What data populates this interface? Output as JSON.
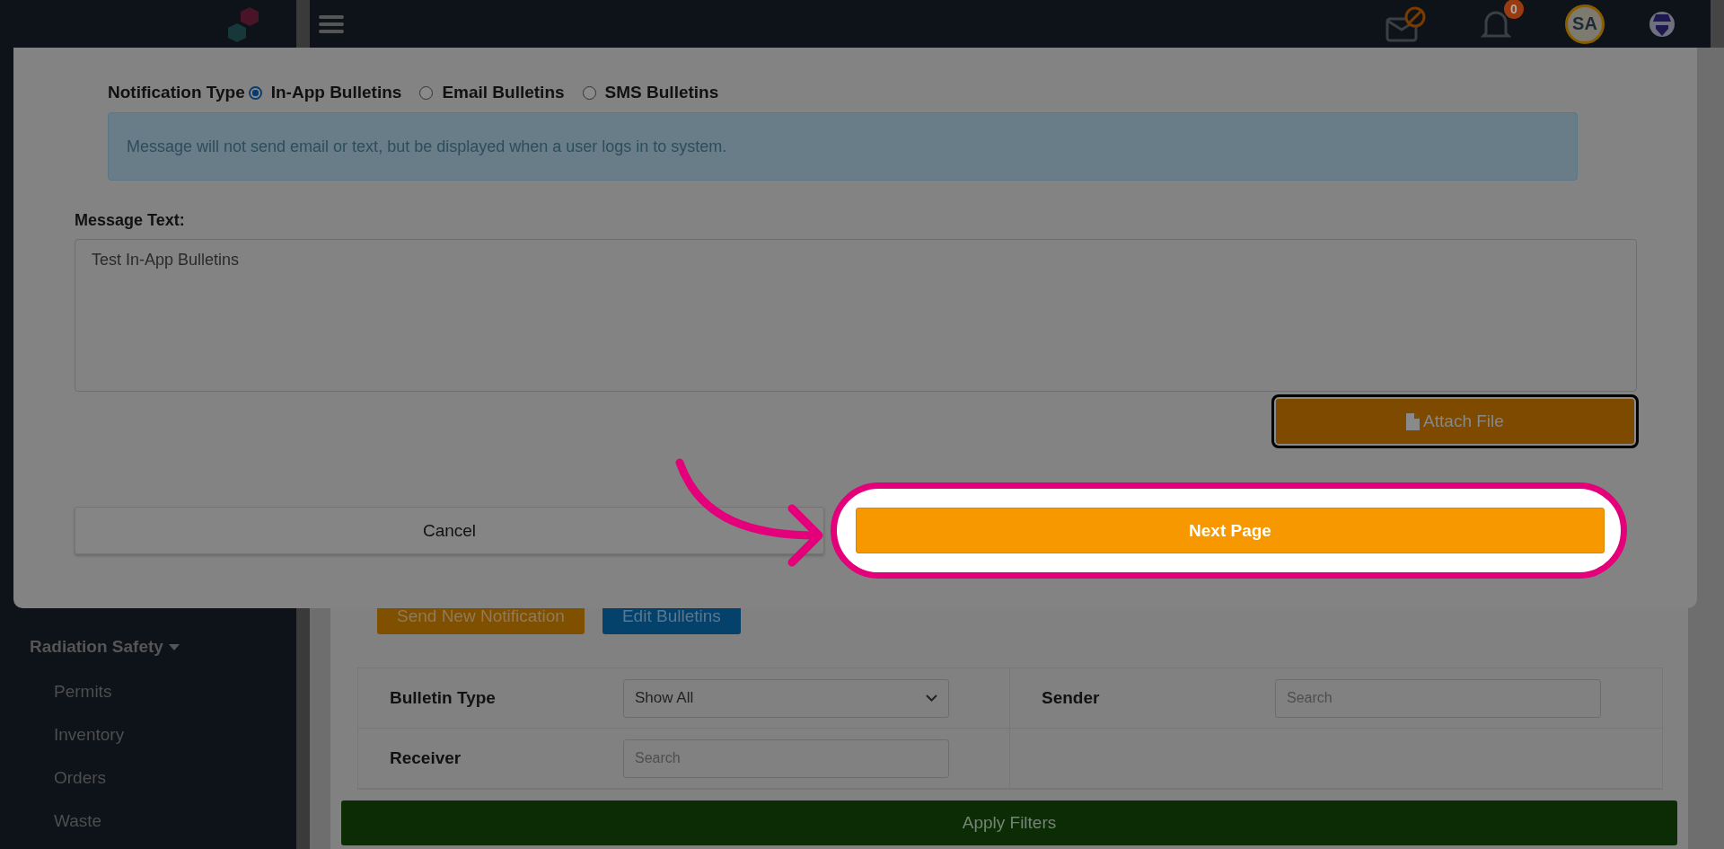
{
  "header": {
    "notification_badge": "0",
    "avatar_initials": "SA"
  },
  "sidebar": {
    "section": {
      "label": "Radiation Safety",
      "expanded": true
    },
    "items": [
      "Permits",
      "Inventory",
      "Orders",
      "Waste"
    ]
  },
  "main": {
    "buttons": [
      {
        "label": "Send New Notification",
        "kind": "primary"
      },
      {
        "label": "Edit Bulletins",
        "kind": "secondary"
      }
    ],
    "filters": {
      "bulletin_type": {
        "label": "Bulletin Type",
        "value": "Show All"
      },
      "sender": {
        "label": "Sender",
        "placeholder": "Search"
      },
      "receiver": {
        "label": "Receiver",
        "placeholder": "Search"
      }
    },
    "apply_button": "Apply Filters"
  },
  "modal": {
    "notification_type": {
      "label": "Notification Type",
      "options": [
        {
          "label": "In-App Bulletins",
          "selected": true
        },
        {
          "label": "Email Bulletins",
          "selected": false
        },
        {
          "label": "SMS Bulletins",
          "selected": false
        }
      ]
    },
    "info": "Message will not send email or text, but be displayed when a user logs in to system.",
    "message_label": "Message Text:",
    "message_value": "Test In-App Bulletins",
    "attach_button": "Attach File",
    "cancel_button": "Cancel",
    "next_button": "Next Page",
    "next_highlighted": true
  }
}
